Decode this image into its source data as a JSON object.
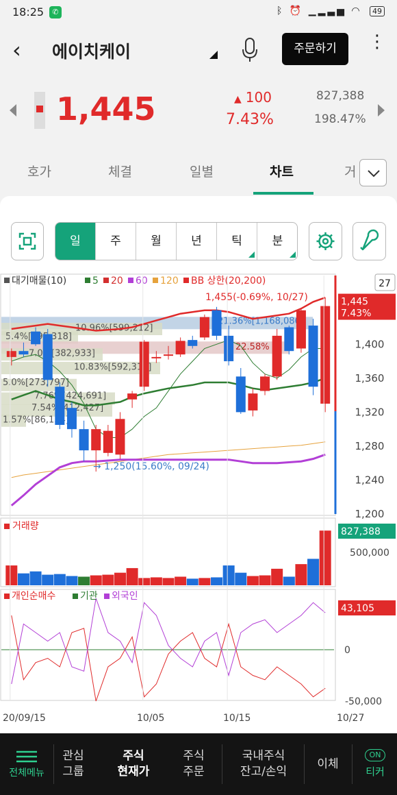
{
  "status": {
    "time": "18:25",
    "battery": "49"
  },
  "header": {
    "title": "에이치케이",
    "order_label": "주문하기"
  },
  "quote": {
    "price": "1,445",
    "change": "100",
    "change_pct": "7.43%",
    "volume": "827,388",
    "volume_pct": "198.47%"
  },
  "tabs": [
    {
      "label": "호가"
    },
    {
      "label": "체결"
    },
    {
      "label": "일별"
    },
    {
      "label": "차트"
    },
    {
      "label": "거"
    }
  ],
  "periods": [
    "일",
    "주",
    "월",
    "년",
    "틱",
    "분"
  ],
  "chart_header": {
    "legend_items": [
      "대기매물(10)",
      "5",
      "20",
      "60",
      "120",
      "BB 상한(20,200)"
    ],
    "count_box": "27",
    "high_note": "1,455(-0.69%, 10/27)",
    "low_note": "1,250(15.60%, 09/24)",
    "last_price": "1,445",
    "last_pct": "7.43%",
    "last_volume": "827,388",
    "last_net": "43,105"
  },
  "volume_profile": [
    "21.36%[1,168,086]",
    "10.96%[599,212]",
    "5.4%[295,318]",
    "22.58%",
    "7.0%[382,933]",
    "10.83%[592,314]",
    "5.0%[273,797]",
    "7.76%[424,691]",
    "7.54%[412,427]",
    "1.57%[86,134]"
  ],
  "price_axis": [
    "1,400",
    "1,360",
    "1,320",
    "1,280",
    "1,240",
    "1,200"
  ],
  "volume_panel": {
    "label": "거래량",
    "axis": "500,000"
  },
  "flow_panel": {
    "labels": [
      "개인순매수",
      "기관",
      "외국인"
    ],
    "axis": [
      "0",
      "-50,000"
    ]
  },
  "x_axis": [
    "20/09/15",
    "10/05",
    "10/15",
    "10/27"
  ],
  "colors": {
    "up": "#e02a2a",
    "down": "#1e6fd9",
    "accent": "#15a37a",
    "ma5": "#2e7d32",
    "ma20": "#d32f2f",
    "ma60": "#b23fd6",
    "ma120": "#e6a23c"
  },
  "chart_data": {
    "type": "candlestick",
    "dates": [
      "09/15",
      "09/16",
      "09/17",
      "09/18",
      "09/21",
      "09/22",
      "09/23",
      "09/24",
      "09/25",
      "09/28",
      "09/29",
      "10/05",
      "10/06",
      "10/07",
      "10/08",
      "10/12",
      "10/13",
      "10/14",
      "10/15",
      "10/16",
      "10/19",
      "10/20",
      "10/21",
      "10/22",
      "10/23",
      "10/26",
      "10/27"
    ],
    "ohlc": [
      [
        1385,
        1395,
        1375,
        1392
      ],
      [
        1392,
        1402,
        1385,
        1388
      ],
      [
        1415,
        1420,
        1398,
        1400
      ],
      [
        1412,
        1418,
        1350,
        1358
      ],
      [
        1350,
        1355,
        1300,
        1305
      ],
      [
        1325,
        1332,
        1290,
        1300
      ],
      [
        1300,
        1310,
        1262,
        1275
      ],
      [
        1275,
        1305,
        1250,
        1300
      ],
      [
        1272,
        1305,
        1268,
        1298
      ],
      [
        1270,
        1320,
        1265,
        1312
      ],
      [
        1335,
        1345,
        1325,
        1342
      ],
      [
        1350,
        1405,
        1345,
        1403
      ],
      [
        1385,
        1392,
        1378,
        1385
      ],
      [
        1388,
        1398,
        1382,
        1388
      ],
      [
        1388,
        1408,
        1385,
        1404
      ],
      [
        1405,
        1410,
        1395,
        1398
      ],
      [
        1408,
        1435,
        1405,
        1432
      ],
      [
        1440,
        1444,
        1405,
        1410
      ],
      [
        1410,
        1422,
        1375,
        1380
      ],
      [
        1362,
        1372,
        1318,
        1320
      ],
      [
        1322,
        1348,
        1315,
        1342
      ],
      [
        1345,
        1365,
        1340,
        1362
      ],
      [
        1362,
        1418,
        1358,
        1410
      ],
      [
        1420,
        1422,
        1388,
        1392
      ],
      [
        1395,
        1442,
        1390,
        1440
      ],
      [
        1422,
        1430,
        1340,
        1350
      ],
      [
        1330,
        1455,
        1320,
        1445
      ]
    ],
    "volume": [
      300000,
      180000,
      210000,
      160000,
      170000,
      140000,
      130000,
      150000,
      160000,
      190000,
      260000,
      110000,
      120000,
      110000,
      130000,
      100000,
      110000,
      120000,
      300000,
      190000,
      140000,
      150000,
      250000,
      130000,
      320000,
      400000,
      827388
    ],
    "y_range": [
      1200,
      1460
    ],
    "ma5": [
      1380,
      1385,
      1388,
      1380,
      1368,
      1352,
      1330,
      1300,
      1290,
      1290,
      1300,
      1315,
      1325,
      1345,
      1365,
      1380,
      1395,
      1400,
      1405,
      1398,
      1378,
      1365,
      1360,
      1370,
      1385,
      1395,
      1395
    ],
    "ma20": [
      1335,
      1340,
      1345,
      1340,
      1335,
      1332,
      1328,
      1328,
      1330,
      1332,
      1338,
      1342,
      1345,
      1348,
      1350,
      1352,
      1355,
      1355,
      1355,
      1352,
      1348,
      1346,
      1348,
      1350,
      1352,
      1355,
      1360
    ],
    "ma60": [
      1210,
      1222,
      1235,
      1245,
      1255,
      1260,
      1262,
      1262,
      1263,
      1264,
      1264,
      1264,
      1264,
      1264,
      1264,
      1264,
      1264,
      1264,
      1264,
      1262,
      1260,
      1260,
      1260,
      1261,
      1262,
      1265,
      1270
    ],
    "ma120": [
      1243,
      1246,
      1248,
      1250,
      1252,
      1254,
      1256,
      1258,
      1260,
      1262,
      1264,
      1266,
      1268,
      1270,
      1271,
      1272,
      1273,
      1274,
      1275,
      1276,
      1277,
      1278,
      1279,
      1280,
      1281,
      1283,
      1285
    ],
    "bb_upper": [
      1418,
      1420,
      1422,
      1424,
      1422,
      1420,
      1418,
      1416,
      1417,
      1418,
      1420,
      1424,
      1428,
      1432,
      1436,
      1438,
      1440,
      1440,
      1438,
      1434,
      1430,
      1432,
      1434,
      1436,
      1442,
      1450,
      1455
    ],
    "net_individual": [
      40000,
      -35000,
      -15000,
      -10000,
      -20000,
      20000,
      25000,
      -60000,
      -20000,
      -10000,
      15000,
      -55000,
      -40000,
      -5000,
      10000,
      20000,
      -10000,
      -20000,
      30000,
      -20000,
      -30000,
      -35000,
      -20000,
      -30000,
      -40000,
      -55000,
      -45000
    ],
    "net_foreign": [
      -40000,
      30000,
      20000,
      10000,
      20000,
      -20000,
      -25000,
      60000,
      20000,
      10000,
      -15000,
      55000,
      40000,
      5000,
      -10000,
      -20000,
      10000,
      20000,
      -30000,
      20000,
      30000,
      35000,
      20000,
      30000,
      40000,
      55000,
      43105
    ],
    "net_institution": [
      0,
      0,
      0,
      0,
      0,
      0,
      0,
      0,
      0,
      0,
      0,
      0,
      0,
      0,
      0,
      0,
      0,
      0,
      0,
      0,
      0,
      0,
      0,
      0,
      0,
      0,
      0
    ]
  },
  "bottom_nav": [
    {
      "l1": "전체메뉴",
      "l2": ""
    },
    {
      "l1": "관심",
      "l2": "그룹"
    },
    {
      "l1": "주식",
      "l2": "현재가"
    },
    {
      "l1": "주식",
      "l2": "주문"
    },
    {
      "l1": "국내주식",
      "l2": "잔고/손익"
    },
    {
      "l1": "이체",
      "l2": ""
    },
    {
      "l1": "ON",
      "l2": "티커"
    }
  ]
}
